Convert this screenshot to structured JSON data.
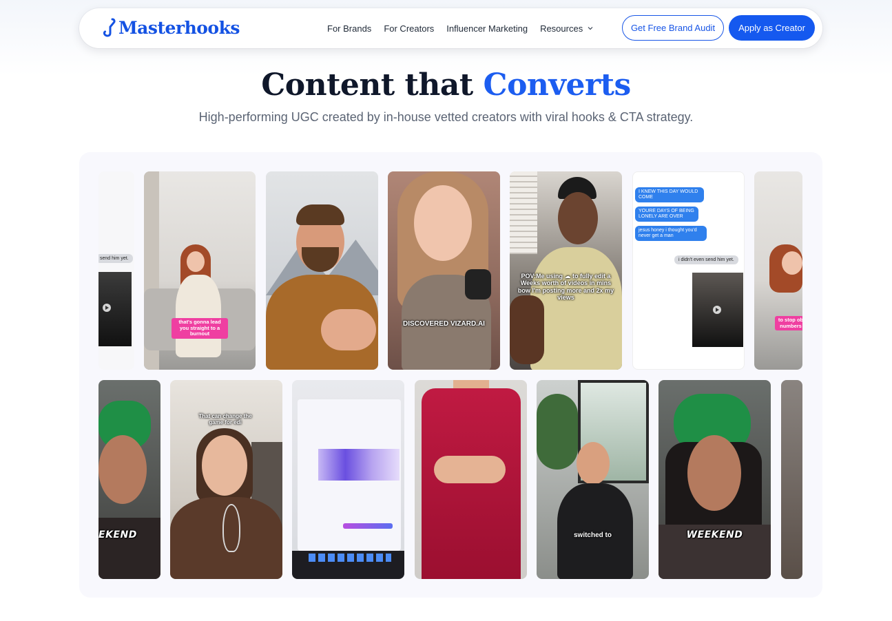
{
  "brand": {
    "name": "Masterhooks",
    "color": "#1755e6"
  },
  "nav": {
    "links": [
      "For Brands",
      "For Creators",
      "Influencer Marketing",
      "Resources"
    ],
    "resources_icon": "chevron-down-icon",
    "audit_button": "Get Free Brand Audit",
    "apply_button": "Apply as Creator"
  },
  "hero": {
    "title_part1": "Content that",
    "title_accent": "Converts",
    "subtitle": "High-performing UGC created by in-house vetted creators with viral hooks & CTA strategy."
  },
  "gallery": {
    "row1": {
      "chat_card_partial": {
        "bubble": "send him yet."
      },
      "burnout_card": {
        "tag": "that's gonna lead you straight to a burnout"
      },
      "vizard_card": {
        "caption": "DISCOVERED VIZARD.AI"
      },
      "pov_card": {
        "caption": "POV:Me using ☁ to fully edit a Weeks worth of videos in mins bow I'm posting more and 2x my views"
      },
      "chat_card": {
        "bubbles_blue": [
          "I KNEW THIS DAY WOULD COME",
          "YOURE DAYS OF BEING LONELY ARE OVER",
          "jesus honey i thought you'd never get a man"
        ],
        "bubble_grey": "i didn't even send him yet."
      },
      "partial_right_card": {
        "tag": "to stop ob numbers"
      }
    },
    "row2": {
      "weekend_partial_card": {
        "caption": "EKEND"
      },
      "whisk_card": {
        "caption": "That can change the game for edi"
      },
      "switched_card": {
        "caption": "switched to"
      },
      "weekend_card": {
        "caption": "WEEKEND"
      }
    }
  },
  "colors": {
    "accent": "#1c5df0",
    "button": "#1559ef",
    "pink_tag": "#ef3fa1",
    "chat_blue": "#2f80ed"
  }
}
